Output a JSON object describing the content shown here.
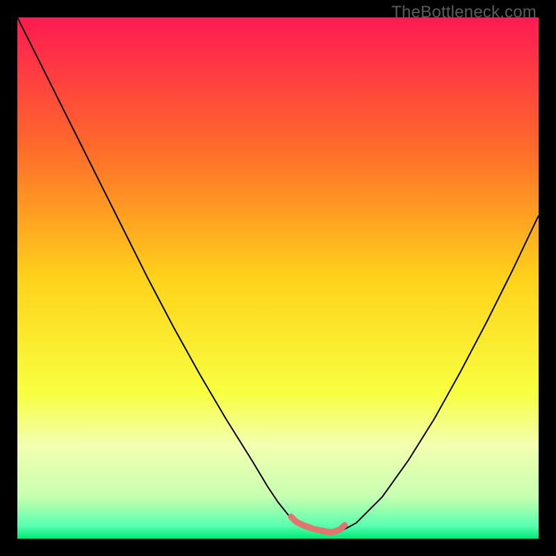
{
  "watermark": "TheBottleneck.com",
  "chart_data": {
    "type": "line",
    "title": "",
    "xlabel": "",
    "ylabel": "",
    "xlim": [
      0,
      100
    ],
    "ylim": [
      0,
      100
    ],
    "background_gradient": {
      "stops": [
        {
          "offset": 0.0,
          "color": "#ff1a52"
        },
        {
          "offset": 0.25,
          "color": "#ff6a2a"
        },
        {
          "offset": 0.5,
          "color": "#ffd21a"
        },
        {
          "offset": 0.72,
          "color": "#f8ff40"
        },
        {
          "offset": 0.82,
          "color": "#f3ffb0"
        },
        {
          "offset": 0.92,
          "color": "#c7ffb0"
        },
        {
          "offset": 0.975,
          "color": "#5affb0"
        },
        {
          "offset": 1.0,
          "color": "#00e878"
        }
      ]
    },
    "series": [
      {
        "name": "bottleneck-curve",
        "color": "#000000",
        "width": 2,
        "x": [
          0,
          5,
          10,
          15,
          20,
          25,
          30,
          35,
          40,
          45,
          48,
          50,
          52,
          55,
          58,
          60,
          62,
          65,
          70,
          75,
          80,
          85,
          90,
          95,
          100
        ],
        "y": [
          100,
          90,
          80,
          70,
          60,
          50,
          40.5,
          31.5,
          23,
          15,
          10,
          7,
          4.5,
          2.5,
          1.4,
          1.2,
          1.4,
          3,
          8,
          15,
          23,
          32,
          41.5,
          51.5,
          62
        ]
      },
      {
        "name": "ideal-range-marker",
        "color": "#e2756d",
        "width": 9,
        "linecap": "round",
        "x": [
          52.5,
          53.5,
          55,
          57,
          59,
          60,
          61,
          62,
          62.8
        ],
        "y": [
          4.2,
          3.2,
          2.5,
          1.8,
          1.4,
          1.2,
          1.4,
          1.8,
          2.6
        ]
      }
    ]
  }
}
